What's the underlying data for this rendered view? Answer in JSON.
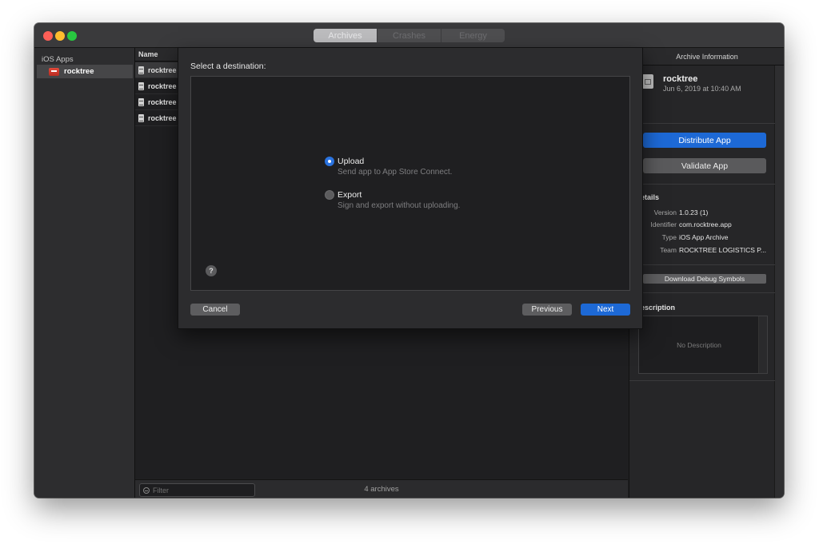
{
  "toolbar": {
    "segments": [
      "Archives",
      "Crashes",
      "Energy"
    ],
    "selected_segment": "Archives",
    "traffic_lights": {
      "close": "#fe5f57",
      "minimize": "#febc2e",
      "zoom": "#28c840"
    }
  },
  "sidebar": {
    "header": "iOS Apps",
    "items": [
      {
        "label": "rocktree",
        "selected": true
      }
    ]
  },
  "archive_list": {
    "column_header": "Name",
    "rows": [
      {
        "name": "rocktree",
        "selected": true
      },
      {
        "name": "rocktree",
        "selected": false
      },
      {
        "name": "rocktree",
        "selected": false
      },
      {
        "name": "rocktree",
        "selected": false
      }
    ],
    "filter_placeholder": "Filter",
    "count_label": "4 archives"
  },
  "inspector": {
    "header": "Archive Information",
    "archive_name": "rocktree",
    "archive_date": "Jun 6, 2019 at 10:40 AM",
    "distribute_label": "Distribute App",
    "validate_label": "Validate App",
    "details_title": "etails",
    "details": [
      {
        "key": "Version",
        "value": "1.0.23 (1)"
      },
      {
        "key": "Identifier",
        "value": "com.rocktree.app"
      },
      {
        "key": "Type",
        "value": "iOS App Archive"
      },
      {
        "key": "Team",
        "value": "ROCKTREE LOGISTICS P..."
      }
    ],
    "debug_symbols_label": "Download Debug Symbols",
    "description_title": "escription",
    "description_placeholder": "No Description"
  },
  "sheet": {
    "title": "Select a destination:",
    "options": [
      {
        "label": "Upload",
        "subtitle": "Send app to App Store Connect.",
        "selected": true
      },
      {
        "label": "Export",
        "subtitle": "Sign and export without uploading.",
        "selected": false
      }
    ],
    "help_label": "?",
    "cancel_label": "Cancel",
    "previous_label": "Previous",
    "next_label": "Next"
  },
  "colors": {
    "accent": "#1d69d6",
    "window_bg": "#1f1f21",
    "sheet_bg": "#2c2c2e"
  }
}
